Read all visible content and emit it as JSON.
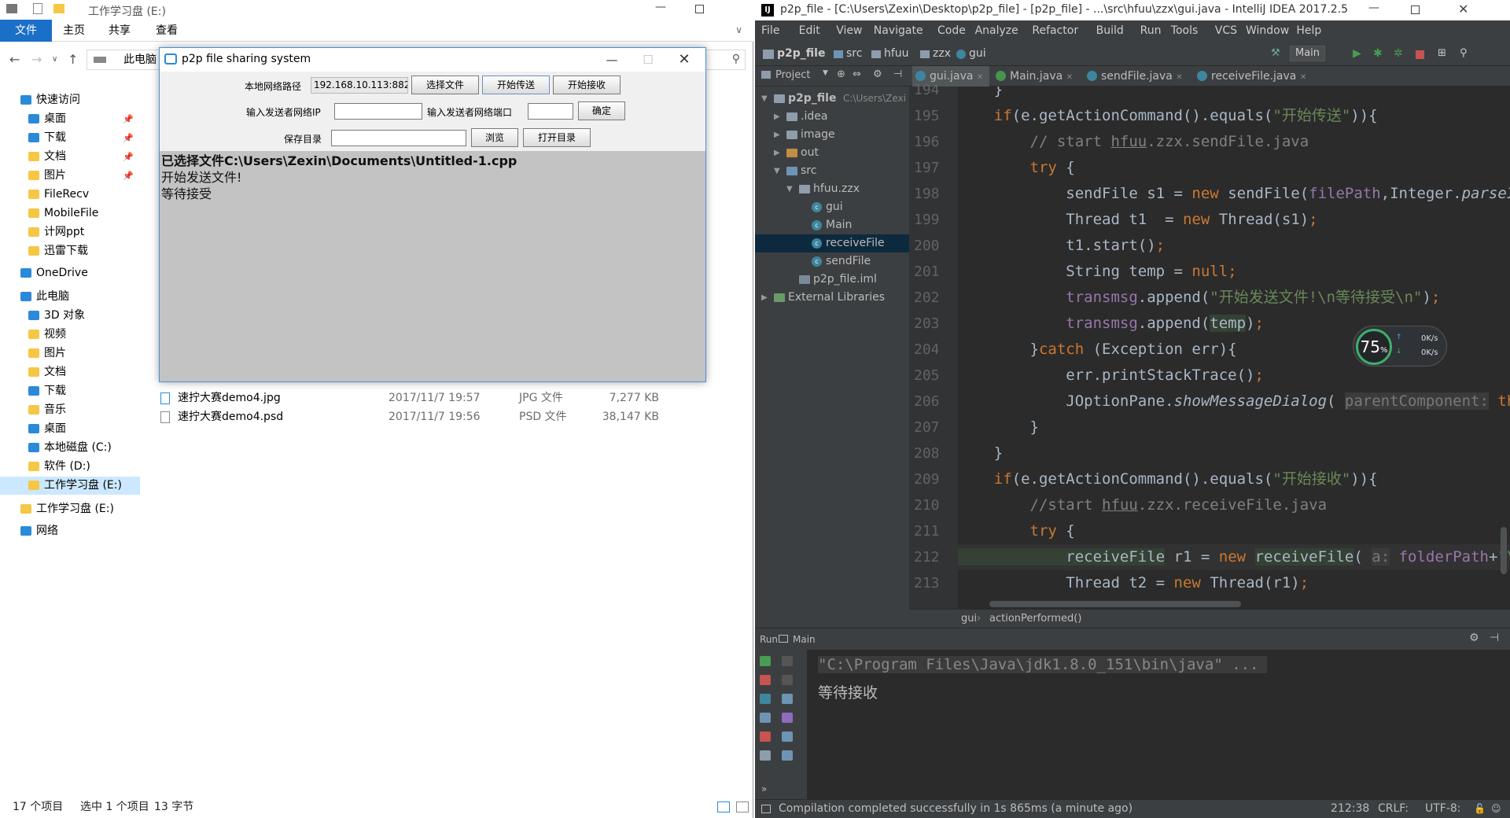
{
  "explorer": {
    "title": "工作学习盘 (E:)",
    "ribbon": [
      "文件",
      "主页",
      "共享",
      "查看"
    ],
    "address": "此电脑",
    "nav": [
      {
        "label": "快速访问",
        "kind": "blue",
        "pinned": false
      },
      {
        "label": "桌面",
        "kind": "blue",
        "pinned": true
      },
      {
        "label": "下载",
        "kind": "blue",
        "pinned": true
      },
      {
        "label": "文档",
        "kind": "folder",
        "pinned": true
      },
      {
        "label": "图片",
        "kind": "folder",
        "pinned": true
      },
      {
        "label": "FileRecv",
        "kind": "folder",
        "pinned": false
      },
      {
        "label": "MobileFile",
        "kind": "folder",
        "pinned": false
      },
      {
        "label": "计网ppt",
        "kind": "folder",
        "pinned": false
      },
      {
        "label": "迅雷下载",
        "kind": "folder",
        "pinned": false
      },
      {
        "label": "OneDrive",
        "kind": "blue",
        "pinned": false
      },
      {
        "label": "此电脑",
        "kind": "blue",
        "pinned": false
      },
      {
        "label": "3D 对象",
        "kind": "blue",
        "pinned": false
      },
      {
        "label": "视频",
        "kind": "folder",
        "pinned": false
      },
      {
        "label": "图片",
        "kind": "folder",
        "pinned": false
      },
      {
        "label": "文档",
        "kind": "folder",
        "pinned": false
      },
      {
        "label": "下载",
        "kind": "blue",
        "pinned": false
      },
      {
        "label": "音乐",
        "kind": "folder",
        "pinned": false
      },
      {
        "label": "桌面",
        "kind": "blue",
        "pinned": false
      },
      {
        "label": "本地磁盘 (C:)",
        "kind": "blue",
        "pinned": false
      },
      {
        "label": "软件 (D:)",
        "kind": "folder",
        "pinned": false
      },
      {
        "label": "工作学习盘 (E:)",
        "kind": "folder",
        "pinned": false
      },
      {
        "label": "工作学习盘 (E:)",
        "kind": "folder",
        "pinned": false
      },
      {
        "label": "网络",
        "kind": "blue",
        "pinned": false
      }
    ],
    "files": [
      {
        "name": "速拧大赛demo4.jpg",
        "date": "2017/11/7 19:57",
        "type": "JPG 文件",
        "size": "7,277 KB"
      },
      {
        "name": "速拧大赛demo4.psd",
        "date": "2017/11/7 19:56",
        "type": "PSD 文件",
        "size": "38,147 KB"
      }
    ],
    "status": {
      "count": "17 个项目",
      "selected": "选中 1 个项目",
      "size": "13 字节"
    }
  },
  "p2p": {
    "title": "p2p file sharing system",
    "local_label": "本地网络路径",
    "local_value": "192.168.10.113:8821",
    "choose_file": "选择文件",
    "start_send": "开始传送",
    "start_receive": "开始接收",
    "sender_ip_label": "输入发送者网络IP",
    "sender_port_label": "输入发送者网络端口",
    "confirm": "确定",
    "save_dir_label": "保存目录",
    "browse": "浏览",
    "open_dir": "打开目录",
    "log": [
      "已选择文件C:\\Users\\Zexin\\Documents\\Untitled-1.cpp",
      "开始发送文件!",
      "等待接受"
    ]
  },
  "ide": {
    "title": "p2p_file - [C:\\Users\\Zexin\\Desktop\\p2p_file] - [p2p_file] - ...\\src\\hfuu\\zzx\\gui.java - IntelliJ IDEA 2017.2.5",
    "menu": [
      "File",
      "Edit",
      "View",
      "Navigate",
      "Code",
      "Analyze",
      "Refactor",
      "Build",
      "Run",
      "Tools",
      "VCS",
      "Window",
      "Help"
    ],
    "crumbs": [
      "p2p_file",
      "src",
      "hfuu",
      "zzx",
      "gui"
    ],
    "run_config": "Main",
    "project_label": "Project",
    "tree": [
      {
        "label": "p2p_file",
        "path": "C:\\Users\\Zexi",
        "depth": 0,
        "kind": "root"
      },
      {
        "label": ".idea",
        "depth": 1,
        "kind": "folder"
      },
      {
        "label": "image",
        "depth": 1,
        "kind": "folder"
      },
      {
        "label": "out",
        "depth": 1,
        "kind": "out"
      },
      {
        "label": "src",
        "depth": 1,
        "kind": "src"
      },
      {
        "label": "hfuu.zzx",
        "depth": 2,
        "kind": "folder"
      },
      {
        "label": "gui",
        "depth": 3,
        "kind": "class"
      },
      {
        "label": "Main",
        "depth": 3,
        "kind": "class"
      },
      {
        "label": "receiveFile",
        "depth": 3,
        "kind": "class"
      },
      {
        "label": "sendFile",
        "depth": 3,
        "kind": "class"
      },
      {
        "label": "p2p_file.iml",
        "depth": 2,
        "kind": "file"
      },
      {
        "label": "External Libraries",
        "depth": 0,
        "kind": "lib"
      }
    ],
    "tabs": [
      "gui.java",
      "Main.java",
      "sendFile.java",
      "receiveFile.java"
    ],
    "lines": [
      "194",
      "195",
      "196",
      "197",
      "198",
      "199",
      "200",
      "201",
      "202",
      "203",
      "204",
      "205",
      "206",
      "207",
      "208",
      "209",
      "210",
      "211",
      "212",
      "213"
    ],
    "nav_path": [
      "gui",
      "actionPerformed()"
    ],
    "run_label": "Run",
    "run_target": "Main",
    "console": [
      "\"C:\\Program Files\\Java\\jdk1.8.0_151\\bin\\java\" ...",
      "等待接收"
    ],
    "status_msg": "Compilation completed successfully in 1s 865ms (a minute ago)",
    "status_right": [
      "212:38",
      "CRLF:",
      "UTF-8:"
    ],
    "speed": {
      "percent": "75",
      "unit": "%",
      "up": "0K/s",
      "down": "0K/s"
    }
  }
}
